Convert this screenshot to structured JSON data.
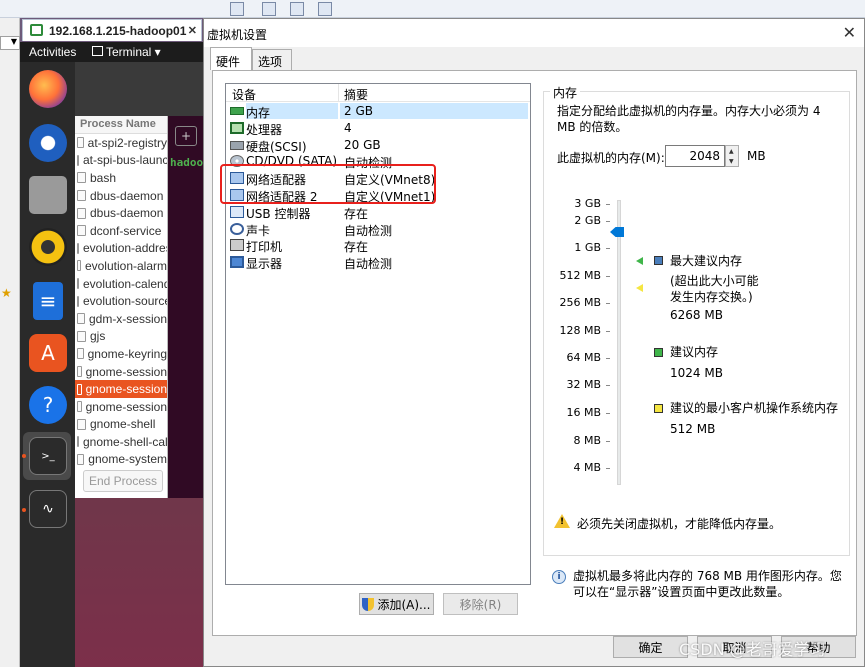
{
  "vm_window": {
    "tab_title": "192.168.1.215-hadoop01",
    "left_combo_arrow": "▼"
  },
  "ubuntu": {
    "activities": "Activities",
    "terminal_menu": "Terminal ▾",
    "process_header": "Process Name",
    "processes": [
      "at-spi2-registry",
      "at-spi-bus-launcher",
      "bash",
      "dbus-daemon",
      "dbus-daemon",
      "dconf-service",
      "evolution-addressbook",
      "evolution-alarm",
      "evolution-calendar",
      "evolution-source",
      "gdm-x-session",
      "gjs",
      "gnome-keyring",
      "gnome-session",
      "gnome-session",
      "gnome-session",
      "gnome-shell",
      "gnome-shell-calendar",
      "gnome-system"
    ],
    "selected_process_index": 14,
    "end_process_button": "End Process",
    "terminal_prompt": "hadoo",
    "terminal_new_tab": "+"
  },
  "dialog": {
    "title": "虚拟机设置",
    "close": "✕",
    "tabs": [
      {
        "label": "硬件",
        "active": true
      },
      {
        "label": "选项",
        "active": false
      }
    ],
    "device_table": {
      "col_device": "设备",
      "col_summary": "摘要",
      "rows": [
        {
          "name": "内存",
          "summary": "2 GB",
          "icon": "memory-icon",
          "selected": true
        },
        {
          "name": "处理器",
          "summary": "4",
          "icon": "cpu-icon"
        },
        {
          "name": "硬盘(SCSI)",
          "summary": "20 GB",
          "icon": "hard-disk-icon"
        },
        {
          "name": "CD/DVD (SATA)",
          "summary": "自动检测",
          "icon": "cd-dvd-icon"
        },
        {
          "name": "网络适配器",
          "summary": "自定义(VMnet8)",
          "icon": "network-adapter-icon"
        },
        {
          "name": "网络适配器 2",
          "summary": "自定义(VMnet1)",
          "icon": "network-adapter-icon"
        },
        {
          "name": "USB 控制器",
          "summary": "存在",
          "icon": "usb-icon"
        },
        {
          "name": "声卡",
          "summary": "自动检测",
          "icon": "sound-card-icon"
        },
        {
          "name": "打印机",
          "summary": "存在",
          "icon": "printer-icon"
        },
        {
          "name": "显示器",
          "summary": "自动检测",
          "icon": "display-icon"
        }
      ]
    },
    "add_button": "添加(A)...",
    "remove_button": "移除(R)",
    "memory": {
      "group_title": "内存",
      "description": "指定分配给此虚拟机的内存量。内存大小必须为 4 MB 的倍数。",
      "field_label": "此虚拟机的内存(M):",
      "value": "2048",
      "unit": "MB",
      "scale": [
        "3 GB",
        "2 GB",
        "1 GB",
        "512 MB",
        "256 MB",
        "128 MB",
        "64 MB",
        "32 MB",
        "16 MB",
        "8 MB",
        "4 MB"
      ],
      "legend": {
        "max_recommended": "最大建议内存",
        "max_note": "(超出此大小可能发生内存交换。)",
        "max_value": "6268 MB",
        "recommended": "建议内存",
        "recommended_value": "1024 MB",
        "min_guest": "建议的最小客户机操作系统内存",
        "min_guest_value": "512 MB"
      },
      "warning": "必须先关闭虚拟机，才能降低内存量。",
      "colors": {
        "max": "#4a7ebb",
        "recommended": "#3fb54a",
        "min": "#f5e642"
      }
    },
    "info": "虚拟机最多将此内存的 768 MB 用作图形内存。您可以在“显示器”设置页面中更改此数量。",
    "ok_button": "确定",
    "cancel_button": "取消",
    "help_button": "帮助"
  },
  "watermark": "CSDN @老哥爱学习"
}
